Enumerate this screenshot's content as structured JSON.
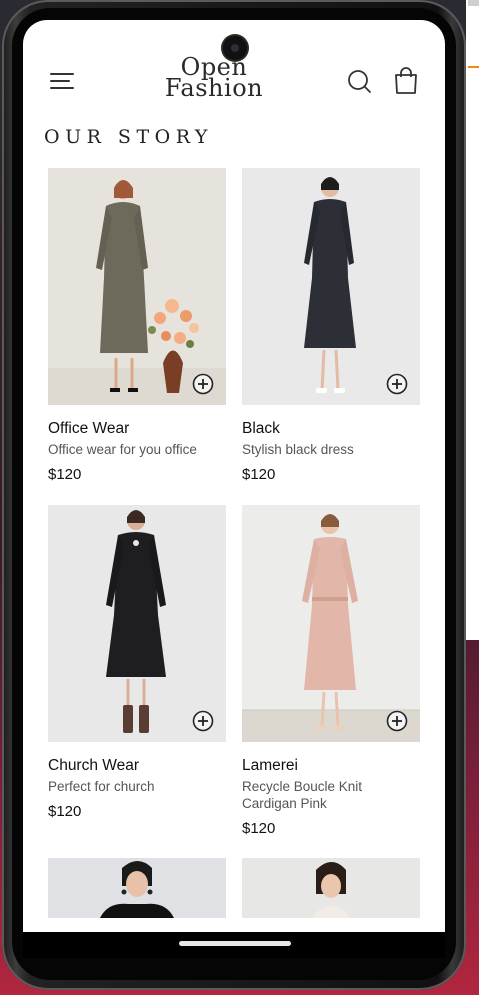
{
  "brand": {
    "line1": "Open",
    "line2": "Fashion"
  },
  "header": {
    "menu_icon": "hamburger-menu-icon",
    "search_icon": "search-icon",
    "bag_icon": "shopping-bag-icon"
  },
  "section": {
    "title": "OUR STORY"
  },
  "products": [
    {
      "name": "Office Wear",
      "description": "Office wear for you office",
      "price": "$120"
    },
    {
      "name": "Black",
      "description": "Stylish black dress",
      "price": "$120"
    },
    {
      "name": "Church Wear",
      "description": "Perfect for church",
      "price": "$120"
    },
    {
      "name": "Lamerei",
      "description": "Recycle Boucle Knit Cardigan Pink",
      "price": "$120"
    }
  ],
  "colors": {
    "text": "#111111",
    "muted": "#555555",
    "office_dress": "#6d6a5c",
    "black_dress": "#2c2f36",
    "pink_dress": "#e2b7aa"
  }
}
